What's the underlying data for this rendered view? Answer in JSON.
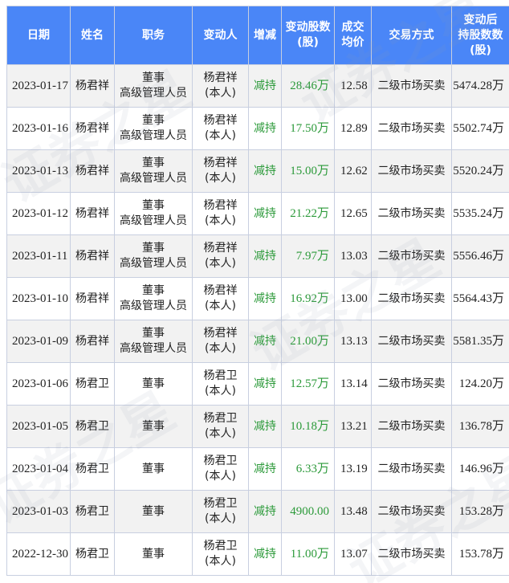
{
  "headers": {
    "date": "日期",
    "name": "姓名",
    "position": "职务",
    "changer": "变动人",
    "action": "增减",
    "change_shares": [
      "变动股数",
      "(股)"
    ],
    "avg_price": [
      "成交",
      "均价"
    ],
    "trade_method": "交易方式",
    "holdings_after": [
      "变动后",
      "持股数数",
      "(股)"
    ]
  },
  "rows": [
    {
      "date": "2023-01-17",
      "name": "杨君祥",
      "position": [
        "董事",
        "高级管理人员"
      ],
      "changer": [
        "杨君祥",
        "(本人)"
      ],
      "action": "减持",
      "amount": "28.46万",
      "price": "12.58",
      "method": "二级市场买卖",
      "holding": "5474.28万"
    },
    {
      "date": "2023-01-16",
      "name": "杨君祥",
      "position": [
        "董事",
        "高级管理人员"
      ],
      "changer": [
        "杨君祥",
        "(本人)"
      ],
      "action": "减持",
      "amount": "17.50万",
      "price": "12.89",
      "method": "二级市场买卖",
      "holding": "5502.74万"
    },
    {
      "date": "2023-01-13",
      "name": "杨君祥",
      "position": [
        "董事",
        "高级管理人员"
      ],
      "changer": [
        "杨君祥",
        "(本人)"
      ],
      "action": "减持",
      "amount": "15.00万",
      "price": "12.62",
      "method": "二级市场买卖",
      "holding": "5520.24万"
    },
    {
      "date": "2023-01-12",
      "name": "杨君祥",
      "position": [
        "董事",
        "高级管理人员"
      ],
      "changer": [
        "杨君祥",
        "(本人)"
      ],
      "action": "减持",
      "amount": "21.22万",
      "price": "12.65",
      "method": "二级市场买卖",
      "holding": "5535.24万"
    },
    {
      "date": "2023-01-11",
      "name": "杨君祥",
      "position": [
        "董事",
        "高级管理人员"
      ],
      "changer": [
        "杨君祥",
        "(本人)"
      ],
      "action": "减持",
      "amount": "7.97万",
      "price": "13.03",
      "method": "二级市场买卖",
      "holding": "5556.46万"
    },
    {
      "date": "2023-01-10",
      "name": "杨君祥",
      "position": [
        "董事",
        "高级管理人员"
      ],
      "changer": [
        "杨君祥",
        "(本人)"
      ],
      "action": "减持",
      "amount": "16.92万",
      "price": "13.00",
      "method": "二级市场买卖",
      "holding": "5564.43万"
    },
    {
      "date": "2023-01-09",
      "name": "杨君祥",
      "position": [
        "董事",
        "高级管理人员"
      ],
      "changer": [
        "杨君祥",
        "(本人)"
      ],
      "action": "减持",
      "amount": "21.00万",
      "price": "13.13",
      "method": "二级市场买卖",
      "holding": "5581.35万"
    },
    {
      "date": "2023-01-06",
      "name": "杨君卫",
      "position": [
        "董事"
      ],
      "changer": [
        "杨君卫",
        "(本人)"
      ],
      "action": "减持",
      "amount": "12.57万",
      "price": "13.14",
      "method": "二级市场买卖",
      "holding": "124.20万"
    },
    {
      "date": "2023-01-05",
      "name": "杨君卫",
      "position": [
        "董事"
      ],
      "changer": [
        "杨君卫",
        "(本人)"
      ],
      "action": "减持",
      "amount": "10.18万",
      "price": "13.21",
      "method": "二级市场买卖",
      "holding": "136.78万"
    },
    {
      "date": "2023-01-04",
      "name": "杨君卫",
      "position": [
        "董事"
      ],
      "changer": [
        "杨君卫",
        "(本人)"
      ],
      "action": "减持",
      "amount": "6.33万",
      "price": "13.19",
      "method": "二级市场买卖",
      "holding": "146.96万"
    },
    {
      "date": "2023-01-03",
      "name": "杨君卫",
      "position": [
        "董事"
      ],
      "changer": [
        "杨君卫",
        "(本人)"
      ],
      "action": "减持",
      "amount": "4900.00",
      "price": "13.48",
      "method": "二级市场买卖",
      "holding": "153.28万"
    },
    {
      "date": "2022-12-30",
      "name": "杨君卫",
      "position": [
        "董事"
      ],
      "changer": [
        "杨君卫",
        "(本人)"
      ],
      "action": "减持",
      "amount": "11.00万",
      "price": "13.07",
      "method": "二级市场买卖",
      "holding": "153.78万"
    }
  ],
  "watermark": "证券之星",
  "colors": {
    "header_bg": "#4a86f7",
    "reduce_green": "#2c9a3a",
    "odd_row": "#f2f2f2"
  }
}
